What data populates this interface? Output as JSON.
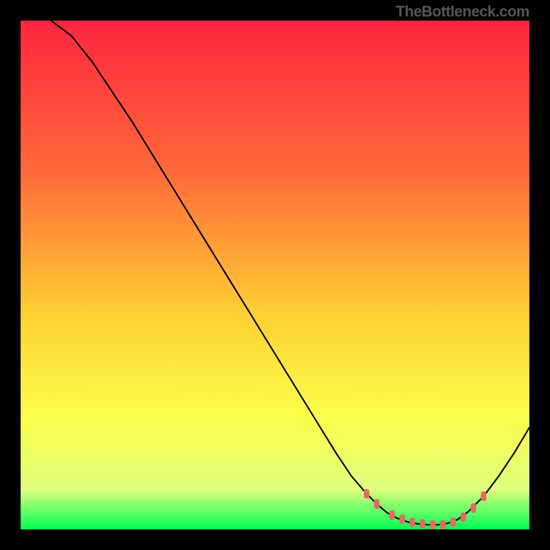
{
  "watermark": "TheBottleneck.com",
  "colors": {
    "gradient_top": "#ff263f",
    "gradient_mid1": "#ff6a3a",
    "gradient_mid2": "#ffd133",
    "gradient_mid3": "#faff4a",
    "gradient_mid4": "#e0ff7d",
    "gradient_bottom": "#00ff55",
    "curve": "#000000",
    "marker": "#e86a5e"
  },
  "chart_data": {
    "type": "line",
    "title": "",
    "xlabel": "",
    "ylabel": "",
    "xlim": [
      0,
      100
    ],
    "ylim": [
      0,
      100
    ],
    "series": [
      {
        "name": "bottleneck-curve",
        "x": [
          6,
          10,
          14,
          18,
          22,
          26,
          30,
          34,
          38,
          42,
          46,
          50,
          54,
          58,
          62,
          65,
          68,
          70,
          72,
          74,
          76,
          78,
          80,
          82,
          84,
          86,
          88,
          91,
          94,
          97,
          100
        ],
        "y": [
          100,
          97,
          92,
          86,
          80,
          73.5,
          67,
          60.5,
          54,
          47.5,
          41,
          34.5,
          28,
          21.5,
          15,
          10.5,
          7,
          5,
          3.3,
          2.2,
          1.5,
          1.1,
          0.9,
          0.9,
          1.2,
          2,
          3.5,
          6.5,
          10.5,
          15,
          20
        ]
      }
    ],
    "markers": {
      "name": "optimal-range-dots",
      "x": [
        68,
        70,
        73,
        75,
        77,
        79,
        81,
        83,
        85,
        87,
        89,
        91
      ],
      "y": [
        7,
        5,
        2.8,
        2,
        1.4,
        1.1,
        0.9,
        0.9,
        1.4,
        2.4,
        4.2,
        6.5
      ]
    }
  }
}
